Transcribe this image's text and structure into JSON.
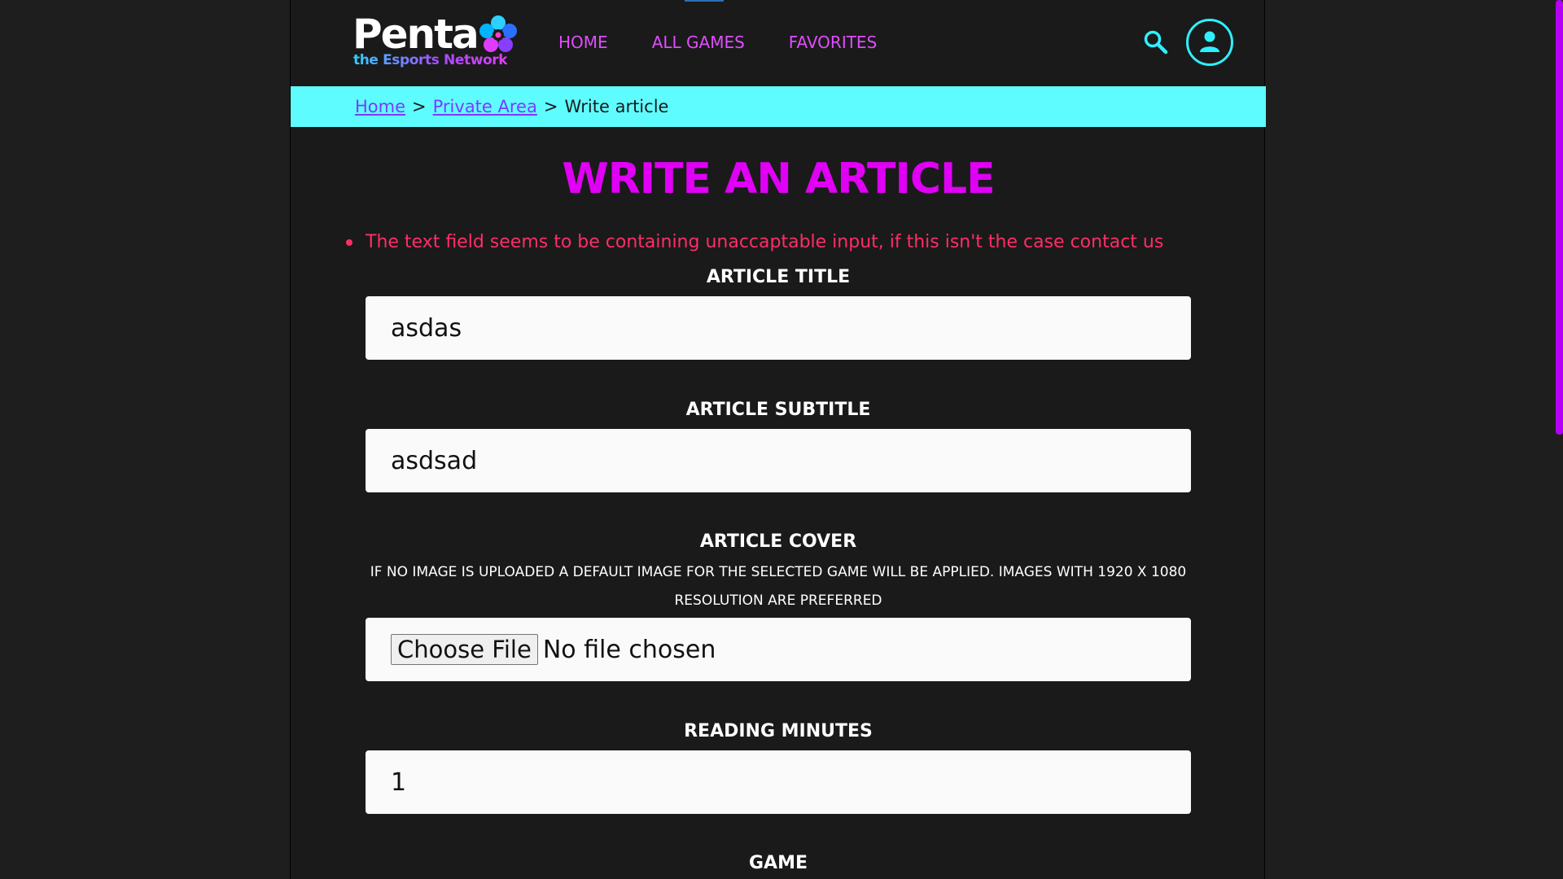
{
  "header": {
    "logo_word": "Penta",
    "logo_tagline": "the Esports Network",
    "nav": [
      {
        "label": "HOME"
      },
      {
        "label": "ALL GAMES"
      },
      {
        "label": "FAVORITES"
      }
    ],
    "search_icon": "search-icon",
    "user_icon": "user-icon"
  },
  "breadcrumb": {
    "items": [
      "Home",
      "Private Area"
    ],
    "separator": ">",
    "current": "Write article"
  },
  "main": {
    "title": "WRITE AN ARTICLE",
    "error": "The text field seems to be containing unaccaptable input, if this isn't the case contact us",
    "fields": {
      "title": {
        "label": "ARTICLE TITLE",
        "value": "asdas"
      },
      "subtitle": {
        "label": "ARTICLE SUBTITLE",
        "value": "asdsad"
      },
      "cover": {
        "label": "ARTICLE COVER",
        "note": "IF NO IMAGE IS UPLOADED A DEFAULT IMAGE FOR THE SELECTED GAME WILL BE APPLIED. IMAGES WITH 1920 X 1080 RESOLUTION ARE PREFERRED",
        "button": "Choose File",
        "status": "No file chosen"
      },
      "minutes": {
        "label": "READING MINUTES",
        "value": "1"
      },
      "game": {
        "label": "GAME"
      }
    }
  },
  "colors": {
    "accent": "#e000f5",
    "cyan": "#5ffcff",
    "error": "#ff2d68",
    "background": "#1a1a1a"
  }
}
